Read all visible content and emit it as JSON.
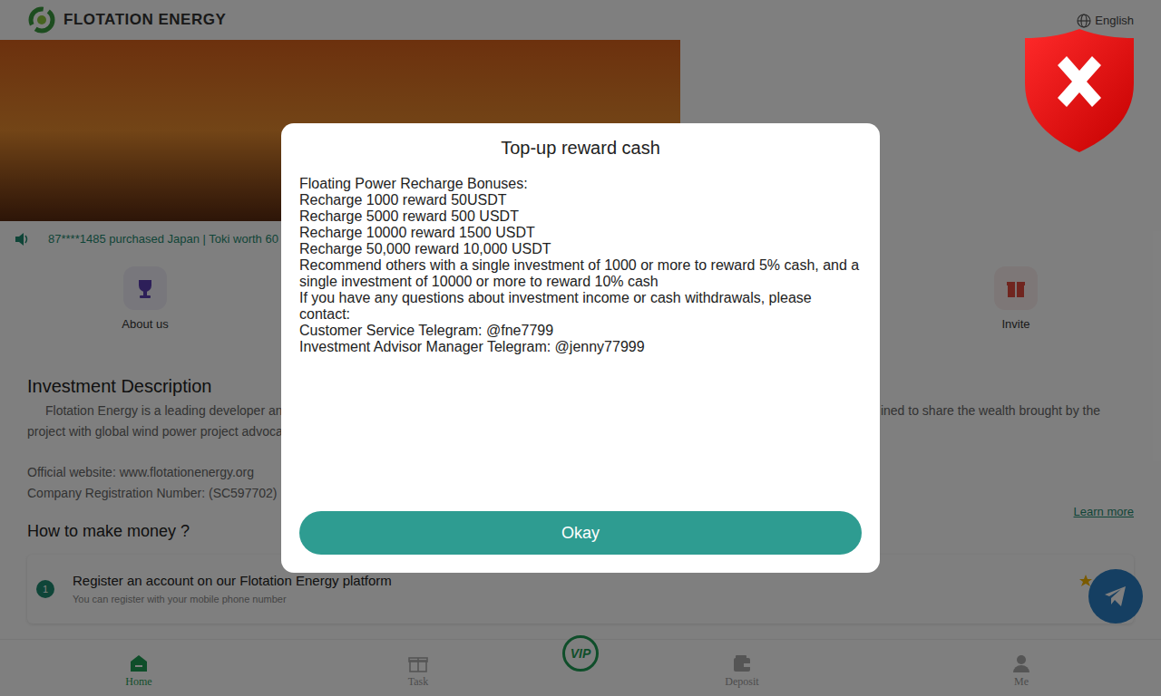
{
  "header": {
    "logo": "FLOTATION ENERGY",
    "language": "English"
  },
  "ticker": "87****1485 purchased Japan | Toki worth 60",
  "shortcuts": [
    {
      "label": "About us"
    },
    {
      "label": "Invite"
    }
  ],
  "description": {
    "title": "Investment Description",
    "line1_left": "Flotation Energy is a leading developer an",
    "line1_right": "ined to share the wealth brought by the",
    "line2": "project with global wind power project advoca",
    "website": "Official website: www.flotationenergy.org",
    "registration": "Company Registration Number: (SC597702)",
    "learn_more": "Learn more"
  },
  "how_to": {
    "title": "How to make money ?",
    "steps": [
      {
        "number": "1",
        "title": "Register an account on our Flotation Energy platform",
        "subtitle": "You can register with your mobile phone number"
      }
    ]
  },
  "modal": {
    "title": "Top-up reward cash",
    "lines": [
      "Floating Power Recharge Bonuses:",
      "Recharge 1000 reward 50USDT",
      "Recharge 5000 reward 500 USDT",
      "Recharge 10000 reward 1500 USDT",
      "Recharge 50,000 reward 10,000 USDT",
      "Recommend others with a single investment of 1000 or more to reward 5% cash, and a single investment of 10000 or more to reward 10% cash",
      "If you have any questions about investment income or cash withdrawals, please contact:",
      "Customer Service Telegram: @fne7799",
      "Investment Advisor Manager Telegram: @jenny77999"
    ],
    "button": "Okay"
  },
  "nav": [
    {
      "label": "Home",
      "kind": "tab",
      "selected": true
    },
    {
      "label": "Task",
      "kind": "tab",
      "selected": false
    },
    {
      "label": "VIP",
      "kind": "vip",
      "selected": false
    },
    {
      "label": "Deposit",
      "kind": "tab",
      "selected": false
    },
    {
      "label": "Me",
      "kind": "tab",
      "selected": false
    }
  ]
}
